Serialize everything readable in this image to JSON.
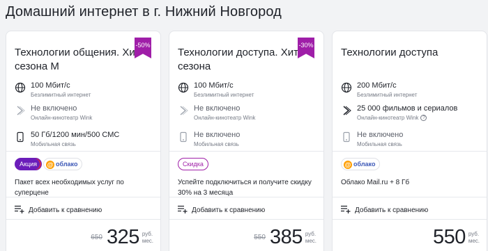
{
  "page": {
    "title": "Домашний интернет в г. Нижний Новгород"
  },
  "cards": [
    {
      "title": "Технологии общения. Хит сезона М",
      "badge": "-50%",
      "features": [
        {
          "icon": "globe-icon",
          "main": "100 Мбит/с",
          "sub": "Безлимитный интернет"
        },
        {
          "icon": "tv-tag-icon",
          "main": "Не включено",
          "sub": "Онлайн-кинотеатр Wink"
        },
        {
          "icon": "phone-icon",
          "main": "50 Гб/1200 мин/500 СМС",
          "sub": "Мобильная связь"
        }
      ],
      "tags": [
        "Акция",
        "облако"
      ],
      "promo_text": "Пакет всех необходимых услуг по суперцене",
      "compare_label": "Добавить к сравнению",
      "old_price": "650",
      "price": "325",
      "unit_top": "руб.",
      "unit_bottom": "мес."
    },
    {
      "title": "Технологии доступа. Хит сезона",
      "badge": "-30%",
      "features": [
        {
          "icon": "globe-icon",
          "main": "100 Мбит/с",
          "sub": "Безлимитный интернет"
        },
        {
          "icon": "tv-tag-icon",
          "main": "Не включено",
          "sub": "Онлайн-кинотеатр Wink"
        },
        {
          "icon": "phone-icon",
          "main": "Не включено",
          "sub": "Мобильная связь"
        }
      ],
      "tags": [
        "Скидка"
      ],
      "promo_text": "Успейте подключиться и получите скидку 30% на 3 месяца",
      "compare_label": "Добавить к сравнению",
      "old_price": "550",
      "price": "385",
      "unit_top": "руб.",
      "unit_bottom": "мес."
    },
    {
      "title": "Технологии доступа",
      "features": [
        {
          "icon": "globe-icon",
          "main": "200 Мбит/с",
          "sub": "Безлимитный интернет"
        },
        {
          "icon": "tv-tag-icon",
          "main": "25 000 фильмов и сериалов",
          "sub": "Онлайн-кинотеатр Wink"
        },
        {
          "icon": "phone-icon",
          "main": "Не включено",
          "sub": "Мобильная связь"
        }
      ],
      "tags": [
        "облако"
      ],
      "promo_text": "Облако Mail.ru + 8 Гб",
      "compare_label": "Добавить к сравнению",
      "price": "550",
      "unit_top": "руб.",
      "unit_bottom": "мес."
    }
  ],
  "colors": {
    "accent_purple": "#9f1ea8",
    "action_purple": "#6b1dba",
    "oblako_orange": "#ff9e00",
    "oblako_blue": "#3c58b7"
  }
}
